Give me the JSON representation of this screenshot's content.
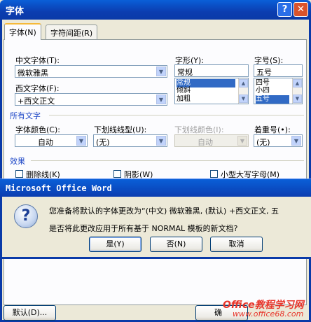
{
  "window": {
    "title": "字体",
    "help": "?",
    "close": "✕"
  },
  "tabs": [
    {
      "label": "字体(N)"
    },
    {
      "label": "字符间距(R)"
    }
  ],
  "fonts": {
    "cn_label": "中文字体(T):",
    "cn_value": "微软雅黑",
    "west_label": "西文字体(F):",
    "west_value": "+西文正文",
    "style_label": "字形(Y):",
    "style_value": "常规",
    "style_items": [
      "常规",
      "倾斜",
      "加粗"
    ],
    "size_label": "字号(S):",
    "size_value": "五号",
    "size_items": [
      "四号",
      "小四",
      "五号"
    ]
  },
  "all_text": {
    "section": "所有文字",
    "color_label": "字体颜色(C):",
    "color_value": "自动",
    "underline_label": "下划线线型(U):",
    "underline_value": "(无)",
    "ucolor_label": "下划线颜色(I):",
    "ucolor_value": "自动",
    "emphasis_label": "着重号(•):",
    "emphasis_value": "(无)"
  },
  "effects": {
    "section": "效果",
    "items": [
      "删除线(K)",
      "阴影(W)",
      "小型大写字母(M)"
    ]
  },
  "message": {
    "title": "Microsoft Office Word",
    "line1": "您准备将默认的字体更改为“(中文) 微软雅黑, (默认) +西文正文, 五",
    "line2": "是否将此更改应用于所有基于 NORMAL 模板的新文档?",
    "yes": "是(Y)",
    "no": "否(N)",
    "cancel": "取消"
  },
  "footer": {
    "default": "默认(D)...",
    "ok": "确"
  },
  "watermark": {
    "line1": "Office教程学习网",
    "line2": "www.office68.com"
  }
}
